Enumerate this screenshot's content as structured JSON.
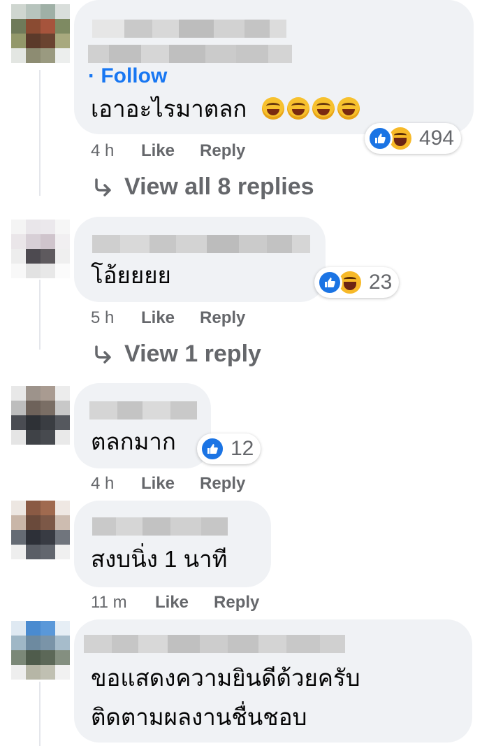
{
  "comments": [
    {
      "follow_label": "· Follow",
      "text": "เอาอะไรมาตลก",
      "emoji_count": 4,
      "reaction_count": "494",
      "time": "4 h",
      "like_label": "Like",
      "reply_label": "Reply",
      "view_replies": "View all 8 replies"
    },
    {
      "text": "โอ้ยยยย",
      "reaction_count": "23",
      "time": "5 h",
      "like_label": "Like",
      "reply_label": "Reply",
      "view_replies": "View 1 reply"
    },
    {
      "text": "ตลกมาก",
      "reaction_count": "12",
      "time": "4 h",
      "like_label": "Like",
      "reply_label": "Reply"
    },
    {
      "text": "สงบนิ่ง 1 นาที",
      "time": "11 m",
      "like_label": "Like",
      "reply_label": "Reply"
    },
    {
      "text_line1": "ขอแสดงความยินดีด้วยครับ",
      "text_line2": "ติดตามผลงานชื่นชอบ"
    }
  ],
  "colors": {
    "bubble": "#f0f2f5",
    "link": "#1877f2",
    "meta": "#65676b",
    "like": "#1b74e4",
    "haha": "#f7b928"
  }
}
